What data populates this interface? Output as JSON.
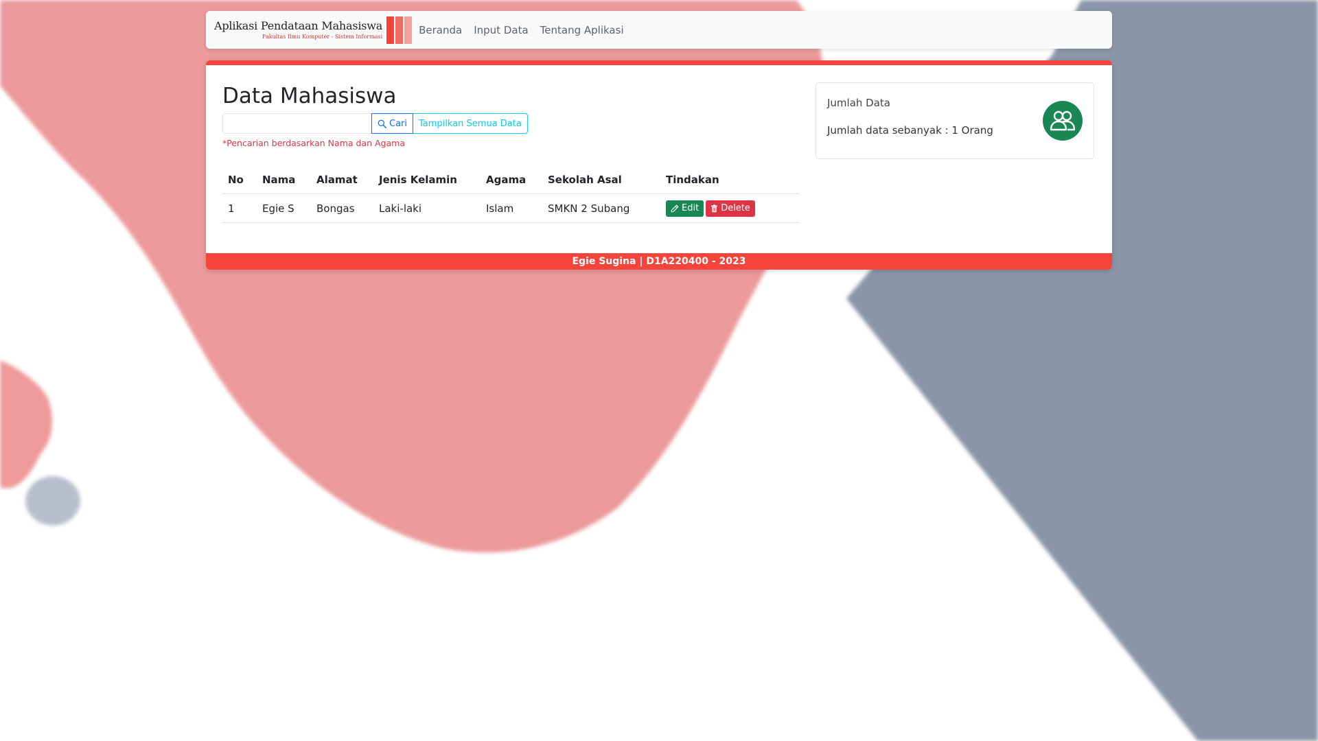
{
  "navbar": {
    "brand_title": "Aplikasi Pendataan Mahasiswa",
    "brand_subtitle": "Fakultas Ilmu Komputer - Sistem Informasi",
    "links": [
      "Beranda",
      "Input Data",
      "Tentang Aplikasi"
    ]
  },
  "main": {
    "title": "Data Mahasiswa",
    "search": {
      "value": "",
      "placeholder": "",
      "button_label": "Cari",
      "show_all_label": "Tampilkan Semua Data",
      "note": "*Pencarian berdasarkan Nama dan Agama"
    },
    "table": {
      "headers": [
        "No",
        "Nama",
        "Alamat",
        "Jenis Kelamin",
        "Agama",
        "Sekolah Asal",
        "Tindakan"
      ],
      "rows": [
        {
          "no": "1",
          "nama": "Egie S",
          "alamat": "Bongas",
          "jenis_kelamin": "Laki-laki",
          "agama": "Islam",
          "sekolah_asal": "SMKN 2 Subang"
        }
      ],
      "edit_label": "Edit",
      "delete_label": "Delete"
    }
  },
  "info_card": {
    "title": "Jumlah Data",
    "count_text": "Jumlah data sebanyak : 1 Orang",
    "icon": "users-icon"
  },
  "footer": {
    "text": "Egie Sugina | D1A220400 - 2023"
  },
  "colors": {
    "accent_red": "#f4443c",
    "success_green": "#198754",
    "danger_red": "#dc3545",
    "primary_blue": "#0d6efd",
    "info_cyan": "#0dcaf0"
  }
}
